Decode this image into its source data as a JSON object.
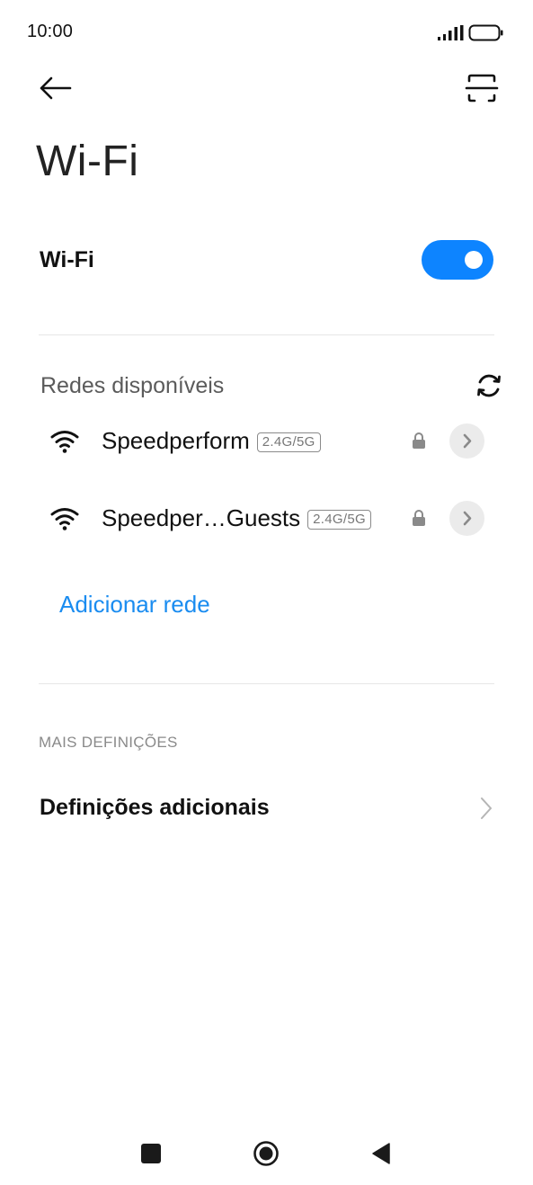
{
  "status_bar": {
    "time": "10:00",
    "icons": [
      "signal-icon",
      "battery-icon"
    ]
  },
  "header": {
    "back_icon": "arrow-left-icon",
    "scan_icon": "qr-scan-icon",
    "title": "Wi-Fi"
  },
  "wifi_toggle": {
    "label": "Wi-Fi",
    "enabled": true,
    "accent_color": "#0d84ff"
  },
  "available_networks": {
    "header": "Redes disponíveis",
    "refresh_icon": "refresh-icon",
    "items": [
      {
        "name": "Speedperform",
        "band": "2.4G/5G",
        "secured": true
      },
      {
        "name": "Speedper…Guests",
        "band": "2.4G/5G",
        "secured": true
      }
    ],
    "add_network": "Adicionar rede",
    "link_color": "#1a8cf0"
  },
  "more_settings": {
    "header": "MAIS DEFINIÇÕES",
    "additional_label": "Definições adicionais"
  },
  "nav_bar": {
    "icons": [
      "recents-icon",
      "home-icon",
      "back-triangle-icon"
    ]
  }
}
